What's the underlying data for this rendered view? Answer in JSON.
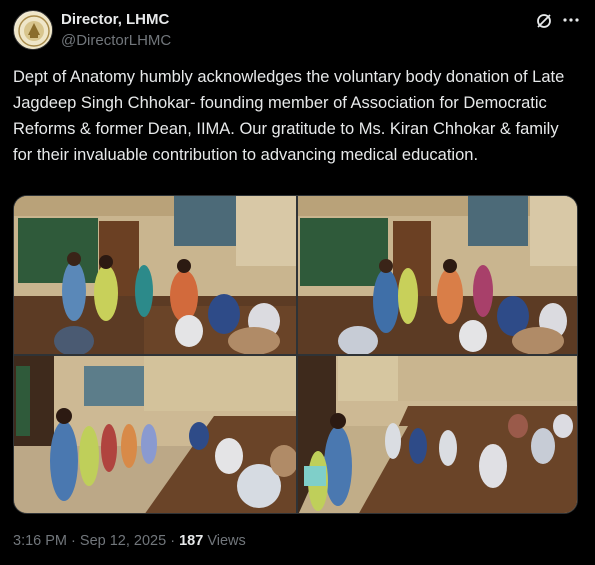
{
  "author": {
    "name": "Director, LHMC",
    "handle": "@DirectorLHMC",
    "avatar_icon": "institution-seal-icon"
  },
  "header_icons": {
    "grok": "grok-icon",
    "more": "more-options-icon"
  },
  "tweet": {
    "text": "Dept of Anatomy humbly acknowledges the voluntary body donation of Late Jagdeep Singh Chhokar- founding member of Association for Democratic Reforms & former Dean, IIMA. Our gratitude to Ms. Kiran Chhokar & family for their invaluable contribution to advancing medical education."
  },
  "media": {
    "count": 4,
    "photos": [
      "photo-1",
      "photo-2",
      "photo-3",
      "photo-4"
    ]
  },
  "meta": {
    "time": "3:16 PM",
    "separator": "·",
    "date": "Sep 12, 2025",
    "views_count": "187",
    "views_label": "Views"
  },
  "colors": {
    "background": "#000000",
    "text": "#e7e9ea",
    "secondary": "#71767b",
    "border": "#2f3336"
  }
}
